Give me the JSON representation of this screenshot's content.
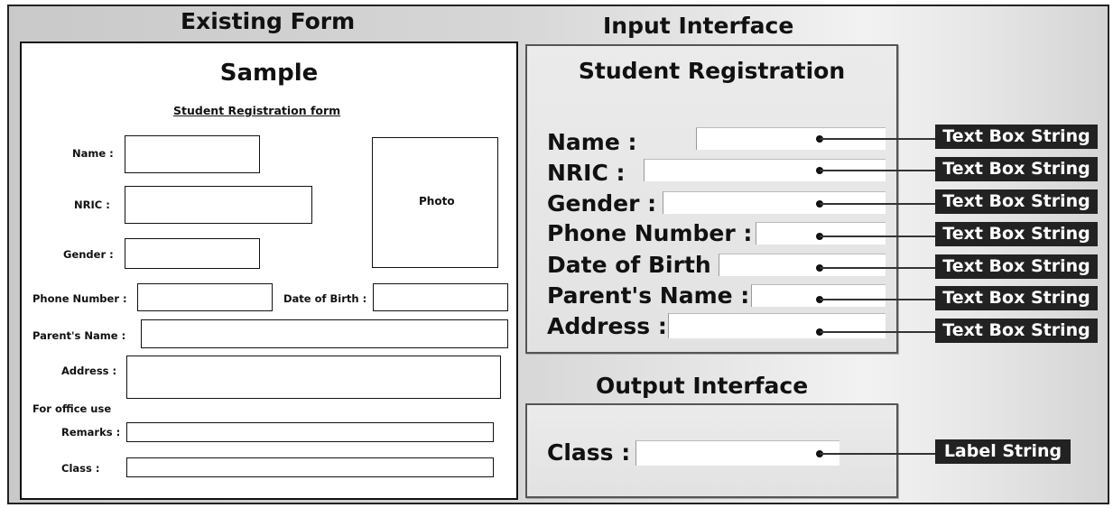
{
  "existing_form": {
    "heading": "Existing Form",
    "title": "Sample",
    "subtitle": "Student Registration form",
    "labels": {
      "name": "Name :",
      "nric": "NRIC :",
      "gender": "Gender :",
      "phone": "Phone Number :",
      "dob": "Date of Birth :",
      "parent": "Parent's Name :",
      "address": "Address :",
      "office": "For office use",
      "remarks": "Remarks :",
      "class": "Class :"
    },
    "photo": "Photo"
  },
  "input_interface": {
    "heading": "Input Interface",
    "title": "Student Registration",
    "fields": [
      {
        "label": "Name :",
        "tag": "Text Box String"
      },
      {
        "label": "NRIC :",
        "tag": "Text Box String"
      },
      {
        "label": "Gender :",
        "tag": "Text Box String"
      },
      {
        "label": "Phone Number :",
        "tag": "Text Box String"
      },
      {
        "label": "Date of Birth :",
        "tag": "Text Box String"
      },
      {
        "label": "Parent's Name :",
        "tag": "Text Box String"
      },
      {
        "label": "Address :",
        "tag": "Text Box String"
      }
    ]
  },
  "output_interface": {
    "heading": "Output Interface",
    "field": {
      "label": "Class :",
      "tag": "Label String"
    }
  }
}
